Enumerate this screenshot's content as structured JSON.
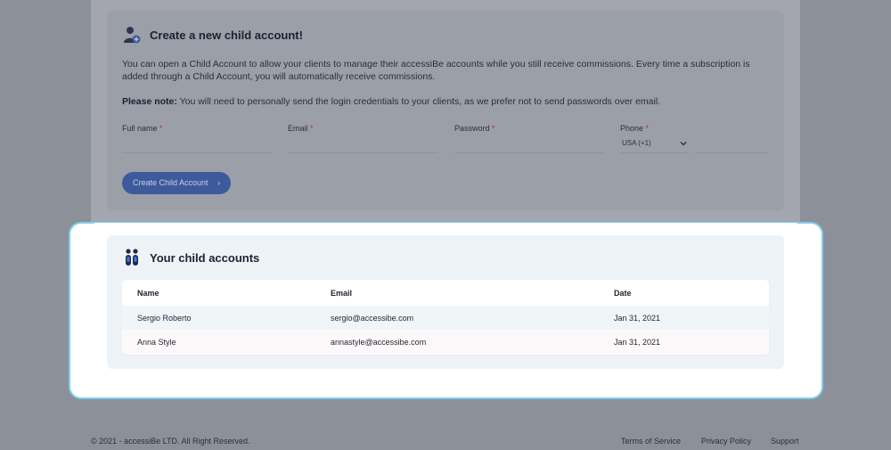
{
  "create_section": {
    "title": "Create a new child account!",
    "description": "You can open a Child Account to allow your clients to manage their accessiBe accounts while you still receive commissions. Every time a subscription is added through a Child Account, you will automatically receive commissions.",
    "note_label": "Please note:",
    "note_text": " You will need to personally send the login credentials to your clients, as we prefer not to send passwords over email.",
    "fields": {
      "full_name": "Full name",
      "email": "Email",
      "password": "Password",
      "phone": "Phone",
      "required_marker": "*"
    },
    "phone_country": "USA (+1)",
    "button_label": "Create Child Account",
    "button_chevron": "›"
  },
  "child_accounts": {
    "title": "Your child accounts",
    "columns": [
      "Name",
      "Email",
      "Date"
    ],
    "rows": [
      {
        "name": "Sergio Roberto",
        "email": "sergio@accessibe.com",
        "date": "Jan 31, 2021"
      },
      {
        "name": "Anna Style",
        "email": "annastyle@accessibe.com",
        "date": "Jan 31, 2021"
      }
    ]
  },
  "footer": {
    "copyright": "© 2021 - accessiBe LTD. All Right Reserved.",
    "links": [
      "Terms of Service",
      "Privacy Policy",
      "Support"
    ]
  },
  "colors": {
    "overlay": "#8c9099",
    "highlight_border": "#7fd0ea",
    "button": "#3d5a9c",
    "panel": "#eef3f7"
  },
  "icons": {
    "create": "add-user-icon",
    "child_accounts": "users-icon",
    "select": "chevron-down-icon"
  }
}
